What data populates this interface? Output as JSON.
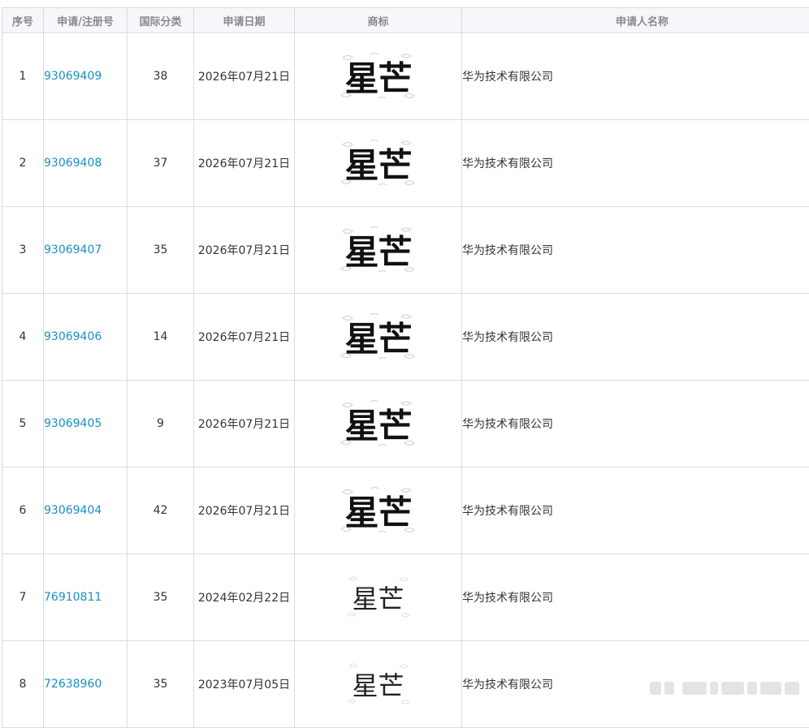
{
  "table": {
    "headers": [
      "序号",
      "申请/注册号",
      "国际分类",
      "申请日期",
      "商标",
      "申请人名称"
    ],
    "rows": [
      {
        "seq": "1",
        "reg_no": "93069409",
        "intl_class": "38",
        "date": "2026年07月21日",
        "mark": "星芒",
        "applicant": "华为技术有限公司"
      },
      {
        "seq": "2",
        "reg_no": "93069408",
        "intl_class": "37",
        "date": "2026年07月21日",
        "mark": "星芒",
        "applicant": "华为技术有限公司"
      },
      {
        "seq": "3",
        "reg_no": "93069407",
        "intl_class": "35",
        "date": "2026年07月21日",
        "mark": "星芒",
        "applicant": "华为技术有限公司"
      },
      {
        "seq": "4",
        "reg_no": "93069406",
        "intl_class": "14",
        "date": "2026年07月21日",
        "mark": "星芒",
        "applicant": "华为技术有限公司"
      },
      {
        "seq": "5",
        "reg_no": "93069405",
        "intl_class": "9",
        "date": "2026年07月21日",
        "mark": "星芒",
        "applicant": "华为技术有限公司"
      },
      {
        "seq": "6",
        "reg_no": "93069404",
        "intl_class": "42",
        "date": "2026年07月21日",
        "mark": "星芒",
        "applicant": "华为技术有限公司"
      },
      {
        "seq": "7",
        "reg_no": "76910811",
        "intl_class": "35",
        "date": "2024年02月22日",
        "mark": "星芒",
        "applicant": "华为技术有限公司"
      },
      {
        "seq": "8",
        "reg_no": "72638960",
        "intl_class": "35",
        "date": "2023年07月05日",
        "mark": "星芒",
        "applicant": "华为技术有限公司"
      }
    ]
  },
  "colors": {
    "link": "#1a8fc4",
    "header_bg": "#f5f7fa",
    "header_text": "#8a8a8a",
    "border": "#dcdcdc"
  }
}
